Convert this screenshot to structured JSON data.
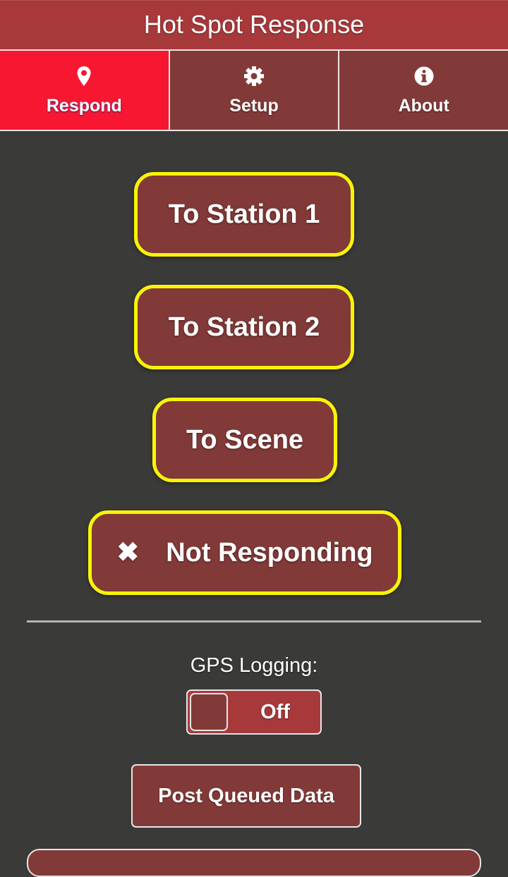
{
  "app": {
    "title": "Hot Spot Response"
  },
  "tabs": [
    {
      "label": "Respond",
      "icon": "map-pin-icon",
      "active": true
    },
    {
      "label": "Setup",
      "icon": "gear-icon",
      "active": false
    },
    {
      "label": "About",
      "icon": "info-icon",
      "active": false
    }
  ],
  "respond": {
    "station1": "To Station 1",
    "station2": "To Station 2",
    "scene": "To Scene",
    "not_responding": "Not Responding",
    "not_responding_icon": "close-icon"
  },
  "gps": {
    "label": "GPS Logging:",
    "toggle_state": "Off"
  },
  "post_queued": {
    "label": "Post Queued Data"
  },
  "colors": {
    "header_bg": "#a8393b",
    "active_tab_bg": "#f71730",
    "tab_bg": "#823a38",
    "button_border": "#f8f409",
    "page_bg": "#3a3a38"
  }
}
